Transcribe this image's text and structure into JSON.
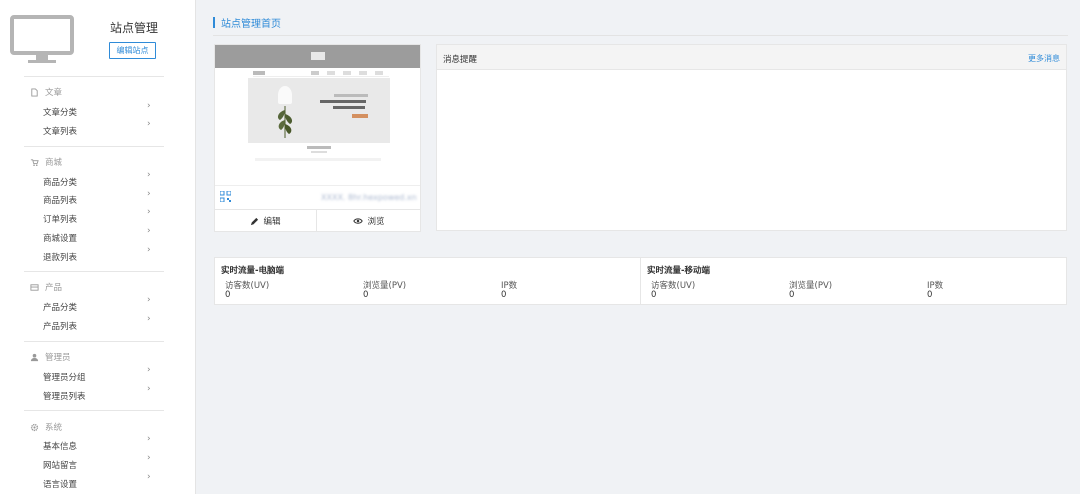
{
  "sidebar": {
    "site_title": "站点管理",
    "edit_site_label": "编辑站点",
    "groups": [
      {
        "title": "文章",
        "icon": "document-icon",
        "items": [
          "文章分类",
          "文章列表"
        ]
      },
      {
        "title": "商城",
        "icon": "cart-icon",
        "items": [
          "商品分类",
          "商品列表",
          "订单列表",
          "商城设置",
          "退款列表"
        ]
      },
      {
        "title": "产品",
        "icon": "box-icon",
        "items": [
          "产品分类",
          "产品列表"
        ]
      },
      {
        "title": "管理员",
        "icon": "user-icon",
        "items": [
          "管理员分组",
          "管理员列表"
        ]
      },
      {
        "title": "系统",
        "icon": "gear-icon",
        "items": [
          "基本信息",
          "网站留言",
          "语言设置"
        ]
      }
    ]
  },
  "main": {
    "breadcrumb": "站点管理首页",
    "preview": {
      "url": "XXXX. 8hr.hexpowed.xn",
      "edit_label": "编辑",
      "browse_label": "浏览"
    },
    "messages": {
      "title": "消息提醒",
      "more_label": "更多消息"
    },
    "traffic": {
      "pc": {
        "title": "实时流量-电脑端",
        "uv_label": "访客数(UV)",
        "uv": "0",
        "pv_label": "浏览量(PV)",
        "pv": "0",
        "ip_label": "IP数",
        "ip": "0"
      },
      "mobile": {
        "title": "实时流量-移动端",
        "uv_label": "访客数(UV)",
        "uv": "0",
        "pv_label": "浏览量(PV)",
        "pv": "0",
        "ip_label": "IP数",
        "ip": "0"
      }
    }
  },
  "colors": {
    "accent": "#2f8bd8",
    "muted": "#999999"
  }
}
